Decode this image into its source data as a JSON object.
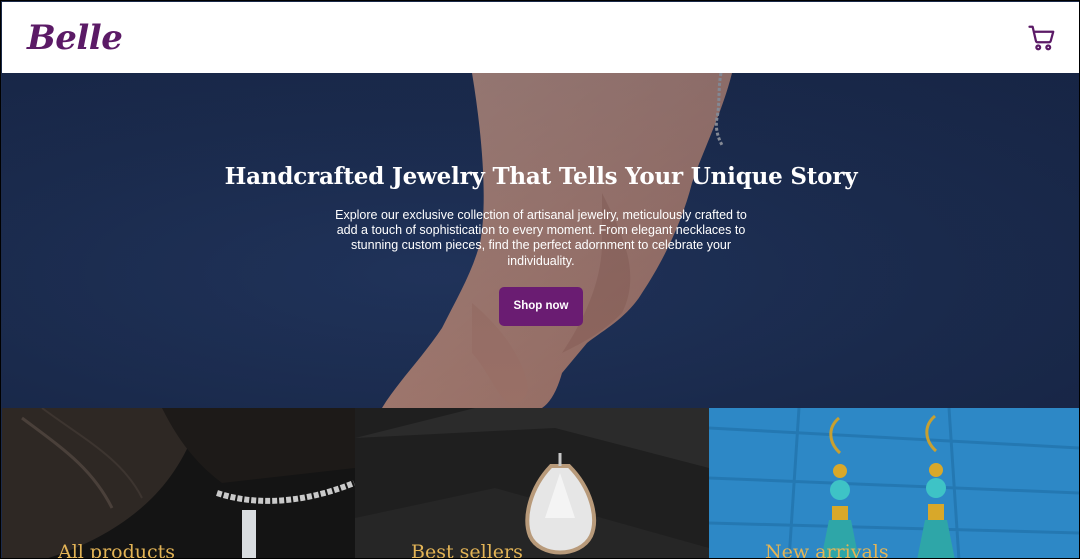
{
  "header": {
    "logo": "Belle",
    "cart_icon": "cart-icon"
  },
  "hero": {
    "title": "Handcrafted Jewelry That Tells Your Unique Story",
    "description": "Explore our exclusive collection of artisanal jewelry, meticulously crafted to add a touch of sophistication to every moment. From elegant necklaces to stunning custom pieces, find the perfect adornment to celebrate your individuality.",
    "button_label": "Shop now",
    "button_color": "#6a1c72"
  },
  "categories": [
    {
      "label": "All products"
    },
    {
      "label": "Best sellers"
    },
    {
      "label": "New arrivals"
    }
  ],
  "colors": {
    "brand": "#5b1a66",
    "hero_bg": "#1b2a4a",
    "category_label": "#e3b456"
  }
}
